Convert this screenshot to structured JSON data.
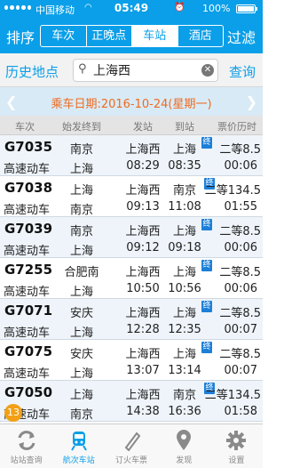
{
  "status_bar": {
    "carrier": "中国移动",
    "time": "05:49",
    "battery": "100%"
  },
  "nav": {
    "sort_label": "排序",
    "filter_label": "过滤",
    "segments": [
      {
        "label": "车次",
        "active": false
      },
      {
        "label": "正晚点",
        "active": false
      },
      {
        "label": "车站",
        "active": true
      },
      {
        "label": "酒店",
        "active": false
      }
    ]
  },
  "search": {
    "history_label": "历史地点",
    "query": "上海西",
    "query_label": "查询"
  },
  "date_bar": {
    "text": "乘车日期:2016-10-24(星期一)"
  },
  "columns": [
    "车次",
    "始发终到",
    "发站",
    "到站",
    "票价历时"
  ],
  "trains": [
    {
      "no": "G7035",
      "type": "高速动车",
      "origin": "南京",
      "dest": "上海",
      "dep_station": "上海西",
      "dep_time": "08:29",
      "arr_station": "上海",
      "arr_time": "08:35",
      "terminal": "终",
      "seat": "二等8.5",
      "duration": "00:06"
    },
    {
      "no": "G7038",
      "type": "高速动车",
      "origin": "上海",
      "dest": "南京",
      "dep_station": "上海西",
      "dep_time": "09:13",
      "arr_station": "南京",
      "arr_time": "11:08",
      "terminal": "终",
      "seat": "二等134.5",
      "duration": "01:55"
    },
    {
      "no": "G7039",
      "type": "高速动车",
      "origin": "南京",
      "dest": "上海",
      "dep_station": "上海西",
      "dep_time": "09:12",
      "arr_station": "上海",
      "arr_time": "09:18",
      "terminal": "终",
      "seat": "二等8.5",
      "duration": "00:06"
    },
    {
      "no": "G7255",
      "type": "高速动车",
      "origin": "合肥南",
      "dest": "上海",
      "dep_station": "上海西",
      "dep_time": "10:50",
      "arr_station": "上海",
      "arr_time": "10:56",
      "terminal": "终",
      "seat": "二等8.5",
      "duration": "00:06"
    },
    {
      "no": "G7071",
      "type": "高速动车",
      "origin": "安庆",
      "dest": "上海",
      "dep_station": "上海西",
      "dep_time": "12:28",
      "arr_station": "上海",
      "arr_time": "12:35",
      "terminal": "终",
      "seat": "二等8.5",
      "duration": "00:07"
    },
    {
      "no": "G7075",
      "type": "高速动车",
      "origin": "安庆",
      "dest": "上海",
      "dep_station": "上海西",
      "dep_time": "13:07",
      "arr_station": "上海",
      "arr_time": "13:14",
      "terminal": "终",
      "seat": "二等8.5",
      "duration": "00:07"
    },
    {
      "no": "G7050",
      "type": "高速动车",
      "origin": "上海",
      "dest": "南京",
      "dep_station": "上海西",
      "dep_time": "14:38",
      "arr_station": "南京",
      "arr_time": "16:36",
      "terminal": "终",
      "seat": "二等134.5",
      "duration": "01:58"
    }
  ],
  "scroll_badge": "13",
  "tabs": [
    {
      "label": "站站查询",
      "icon": "refresh-arrows-icon",
      "active": false
    },
    {
      "label": "航次车站",
      "icon": "train-icon",
      "active": true
    },
    {
      "label": "订火车票",
      "icon": "ticket-icon",
      "active": false
    },
    {
      "label": "发现",
      "icon": "location-pin-icon",
      "active": false
    },
    {
      "label": "设置",
      "icon": "gear-icon",
      "active": false
    }
  ],
  "colors": {
    "primary": "#0a9fe8",
    "date_text": "#ef6a1f",
    "badge": "#f2a015",
    "terminal_badge": "#1c7fd8"
  }
}
